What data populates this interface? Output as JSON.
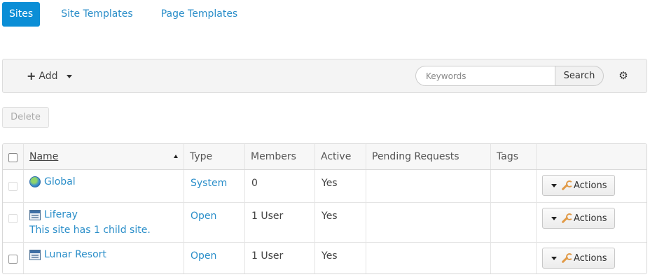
{
  "tabs": [
    {
      "label": "Sites",
      "active": true
    },
    {
      "label": "Site Templates",
      "active": false
    },
    {
      "label": "Page Templates",
      "active": false
    }
  ],
  "toolbar": {
    "add_label": "Add",
    "search_placeholder": "Keywords",
    "search_button": "Search",
    "settings_icon": "gear-icon"
  },
  "delete_label": "Delete",
  "table": {
    "columns": [
      "Name",
      "Type",
      "Members",
      "Active",
      "Pending Requests",
      "Tags",
      ""
    ],
    "sort_column": "Name",
    "rows": [
      {
        "icon": "globe-icon",
        "name": "Global",
        "subtitle": "",
        "type": "System",
        "members": "0",
        "active": "Yes",
        "pending": "",
        "tags": "",
        "action": "Actions"
      },
      {
        "icon": "site-icon",
        "name": "Liferay",
        "subtitle": "This site has 1 child site.",
        "type": "Open",
        "members": "1 User",
        "active": "Yes",
        "pending": "",
        "tags": "",
        "action": "Actions"
      },
      {
        "icon": "site-icon",
        "name": "Lunar Resort",
        "subtitle": "",
        "type": "Open",
        "members": "1 User",
        "active": "Yes",
        "pending": "",
        "tags": "",
        "action": "Actions"
      }
    ]
  },
  "colors": {
    "accent": "#0b8ed6",
    "link": "#2a8ec9"
  }
}
